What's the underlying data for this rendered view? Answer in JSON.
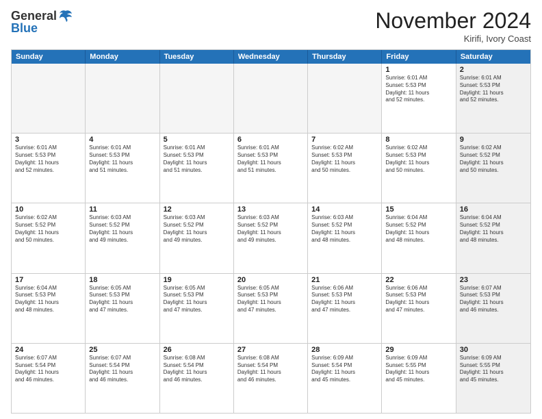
{
  "header": {
    "logo_general": "General",
    "logo_blue": "Blue",
    "month_title": "November 2024",
    "location": "Kirifi, Ivory Coast"
  },
  "calendar": {
    "days_of_week": [
      "Sunday",
      "Monday",
      "Tuesday",
      "Wednesday",
      "Thursday",
      "Friday",
      "Saturday"
    ],
    "weeks": [
      [
        {
          "day": "",
          "info": "",
          "empty": true
        },
        {
          "day": "",
          "info": "",
          "empty": true
        },
        {
          "day": "",
          "info": "",
          "empty": true
        },
        {
          "day": "",
          "info": "",
          "empty": true
        },
        {
          "day": "",
          "info": "",
          "empty": true
        },
        {
          "day": "1",
          "info": "Sunrise: 6:01 AM\nSunset: 5:53 PM\nDaylight: 11 hours\nand 52 minutes."
        },
        {
          "day": "2",
          "info": "Sunrise: 6:01 AM\nSunset: 5:53 PM\nDaylight: 11 hours\nand 52 minutes.",
          "shaded": true
        }
      ],
      [
        {
          "day": "3",
          "info": "Sunrise: 6:01 AM\nSunset: 5:53 PM\nDaylight: 11 hours\nand 52 minutes."
        },
        {
          "day": "4",
          "info": "Sunrise: 6:01 AM\nSunset: 5:53 PM\nDaylight: 11 hours\nand 51 minutes."
        },
        {
          "day": "5",
          "info": "Sunrise: 6:01 AM\nSunset: 5:53 PM\nDaylight: 11 hours\nand 51 minutes."
        },
        {
          "day": "6",
          "info": "Sunrise: 6:01 AM\nSunset: 5:53 PM\nDaylight: 11 hours\nand 51 minutes."
        },
        {
          "day": "7",
          "info": "Sunrise: 6:02 AM\nSunset: 5:53 PM\nDaylight: 11 hours\nand 50 minutes."
        },
        {
          "day": "8",
          "info": "Sunrise: 6:02 AM\nSunset: 5:53 PM\nDaylight: 11 hours\nand 50 minutes."
        },
        {
          "day": "9",
          "info": "Sunrise: 6:02 AM\nSunset: 5:52 PM\nDaylight: 11 hours\nand 50 minutes.",
          "shaded": true
        }
      ],
      [
        {
          "day": "10",
          "info": "Sunrise: 6:02 AM\nSunset: 5:52 PM\nDaylight: 11 hours\nand 50 minutes."
        },
        {
          "day": "11",
          "info": "Sunrise: 6:03 AM\nSunset: 5:52 PM\nDaylight: 11 hours\nand 49 minutes."
        },
        {
          "day": "12",
          "info": "Sunrise: 6:03 AM\nSunset: 5:52 PM\nDaylight: 11 hours\nand 49 minutes."
        },
        {
          "day": "13",
          "info": "Sunrise: 6:03 AM\nSunset: 5:52 PM\nDaylight: 11 hours\nand 49 minutes."
        },
        {
          "day": "14",
          "info": "Sunrise: 6:03 AM\nSunset: 5:52 PM\nDaylight: 11 hours\nand 48 minutes."
        },
        {
          "day": "15",
          "info": "Sunrise: 6:04 AM\nSunset: 5:52 PM\nDaylight: 11 hours\nand 48 minutes."
        },
        {
          "day": "16",
          "info": "Sunrise: 6:04 AM\nSunset: 5:52 PM\nDaylight: 11 hours\nand 48 minutes.",
          "shaded": true
        }
      ],
      [
        {
          "day": "17",
          "info": "Sunrise: 6:04 AM\nSunset: 5:53 PM\nDaylight: 11 hours\nand 48 minutes."
        },
        {
          "day": "18",
          "info": "Sunrise: 6:05 AM\nSunset: 5:53 PM\nDaylight: 11 hours\nand 47 minutes."
        },
        {
          "day": "19",
          "info": "Sunrise: 6:05 AM\nSunset: 5:53 PM\nDaylight: 11 hours\nand 47 minutes."
        },
        {
          "day": "20",
          "info": "Sunrise: 6:05 AM\nSunset: 5:53 PM\nDaylight: 11 hours\nand 47 minutes."
        },
        {
          "day": "21",
          "info": "Sunrise: 6:06 AM\nSunset: 5:53 PM\nDaylight: 11 hours\nand 47 minutes."
        },
        {
          "day": "22",
          "info": "Sunrise: 6:06 AM\nSunset: 5:53 PM\nDaylight: 11 hours\nand 47 minutes."
        },
        {
          "day": "23",
          "info": "Sunrise: 6:07 AM\nSunset: 5:53 PM\nDaylight: 11 hours\nand 46 minutes.",
          "shaded": true
        }
      ],
      [
        {
          "day": "24",
          "info": "Sunrise: 6:07 AM\nSunset: 5:54 PM\nDaylight: 11 hours\nand 46 minutes."
        },
        {
          "day": "25",
          "info": "Sunrise: 6:07 AM\nSunset: 5:54 PM\nDaylight: 11 hours\nand 46 minutes."
        },
        {
          "day": "26",
          "info": "Sunrise: 6:08 AM\nSunset: 5:54 PM\nDaylight: 11 hours\nand 46 minutes."
        },
        {
          "day": "27",
          "info": "Sunrise: 6:08 AM\nSunset: 5:54 PM\nDaylight: 11 hours\nand 46 minutes."
        },
        {
          "day": "28",
          "info": "Sunrise: 6:09 AM\nSunset: 5:54 PM\nDaylight: 11 hours\nand 45 minutes."
        },
        {
          "day": "29",
          "info": "Sunrise: 6:09 AM\nSunset: 5:55 PM\nDaylight: 11 hours\nand 45 minutes."
        },
        {
          "day": "30",
          "info": "Sunrise: 6:09 AM\nSunset: 5:55 PM\nDaylight: 11 hours\nand 45 minutes.",
          "shaded": true
        }
      ]
    ]
  }
}
